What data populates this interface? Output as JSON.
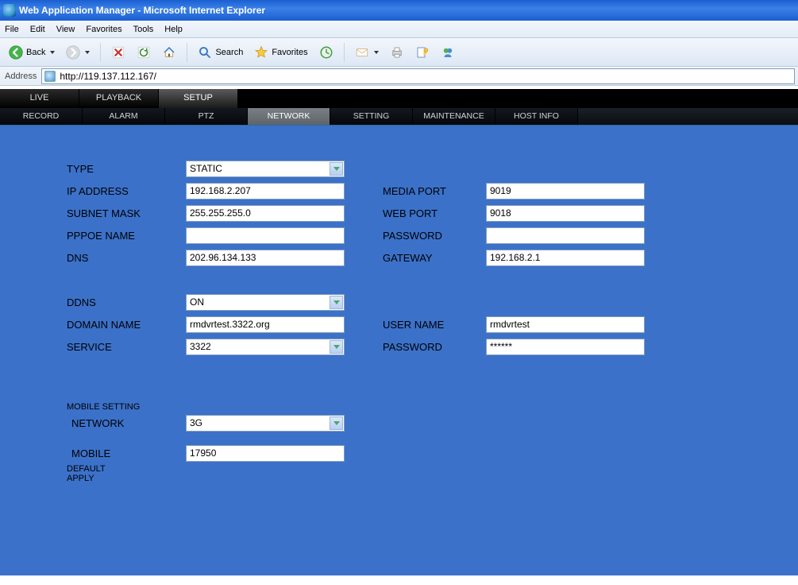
{
  "window": {
    "title": "Web Application Manager - Microsoft Internet Explorer"
  },
  "menu": {
    "file": "File",
    "edit": "Edit",
    "view": "View",
    "favorites": "Favorites",
    "tools": "Tools",
    "help": "Help"
  },
  "toolbar": {
    "back": "Back",
    "search": "Search",
    "favorites": "Favorites"
  },
  "address": {
    "label": "Address",
    "url": "http://119.137.112.167/"
  },
  "tabs1": {
    "live": "LIVE",
    "playback": "PLAYBACK",
    "setup": "SETUP"
  },
  "tabs2": {
    "record": "RECORD",
    "alarm": "ALARM",
    "ptz": "PTZ",
    "network": "NETWORK",
    "setting": "SETTING",
    "maintenance": "MAINTENANCE",
    "hostinfo": "HOST INFO"
  },
  "form": {
    "type_label": "TYPE",
    "type_value": "STATIC",
    "ip_label": "IP ADDRESS",
    "ip": [
      "192",
      "168",
      "2",
      "207"
    ],
    "subnet_label": "SUBNET MASK",
    "subnet": [
      "255",
      "255",
      "255",
      "0"
    ],
    "pppoe_label": "PPPOE NAME",
    "pppoe_value": "",
    "dns_label": "DNS",
    "dns": [
      "202",
      "96",
      "134",
      "133"
    ],
    "mediaport_label": "MEDIA PORT",
    "mediaport_value": "9019",
    "webport_label": "WEB PORT",
    "webport_value": "9018",
    "password_label": "PASSWORD",
    "password_value": "",
    "gateway_label": "GATEWAY",
    "gateway": [
      "192",
      "168",
      "2",
      "1"
    ],
    "ddns_label": "DDNS",
    "ddns_value": "ON",
    "domain_label": "DOMAIN NAME",
    "domain_value": "rmdvrtest.3322.org",
    "service_label": "SERVICE",
    "service_value": "3322",
    "username_label": "USER NAME",
    "username_value": "rmdvrtest",
    "ddns_password_label": "PASSWORD",
    "ddns_password_value": "******",
    "mobile_heading": "MOBILE SETTING",
    "network_label": "NETWORK",
    "network_value": "3G",
    "mobile_label": "MOBILE",
    "mobile_value": "17950"
  },
  "buttons": {
    "default": "DEFAULT",
    "apply": "APPLY"
  }
}
